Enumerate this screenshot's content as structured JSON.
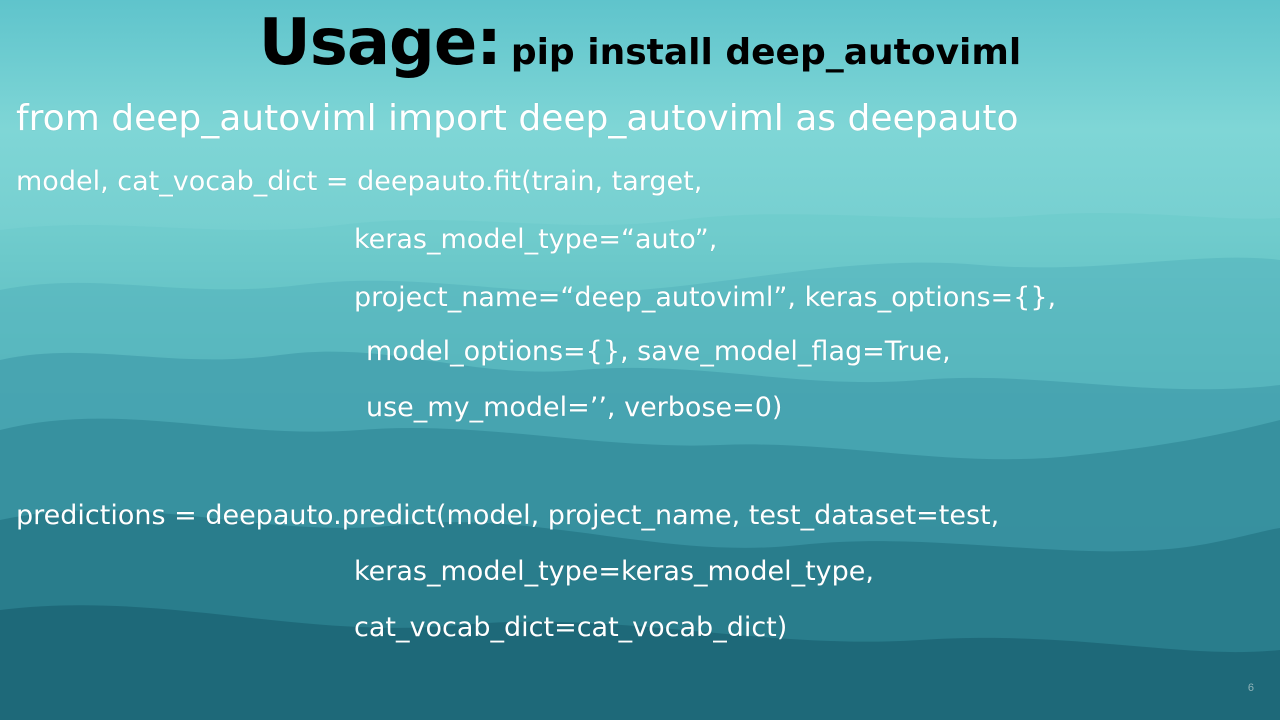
{
  "slide": {
    "title_main": "Usage:",
    "title_sub": "pip install deep_autoviml",
    "import_line": "from deep_autoviml import deep_autoviml as deepauto",
    "fit_lines": [
      "model, cat_vocab_dict = deepauto.fit(train, target,",
      "keras_model_type=“auto”,",
      "project_name=“deep_autoviml”, keras_options={},",
      "model_options={}, save_model_flag=True,",
      "use_my_model=’’, verbose=0)"
    ],
    "predict_lines": [
      "predictions = deepauto.predict(model, project_name, test_dataset=test,",
      "keras_model_type=keras_model_type,",
      "cat_vocab_dict=cat_vocab_dict)"
    ],
    "page_number": "6"
  },
  "colors": {
    "title_text": "#000000",
    "code_text": "#ffffff",
    "background_top": "#5fc4cc",
    "background_bottom": "#1f6f7f"
  }
}
